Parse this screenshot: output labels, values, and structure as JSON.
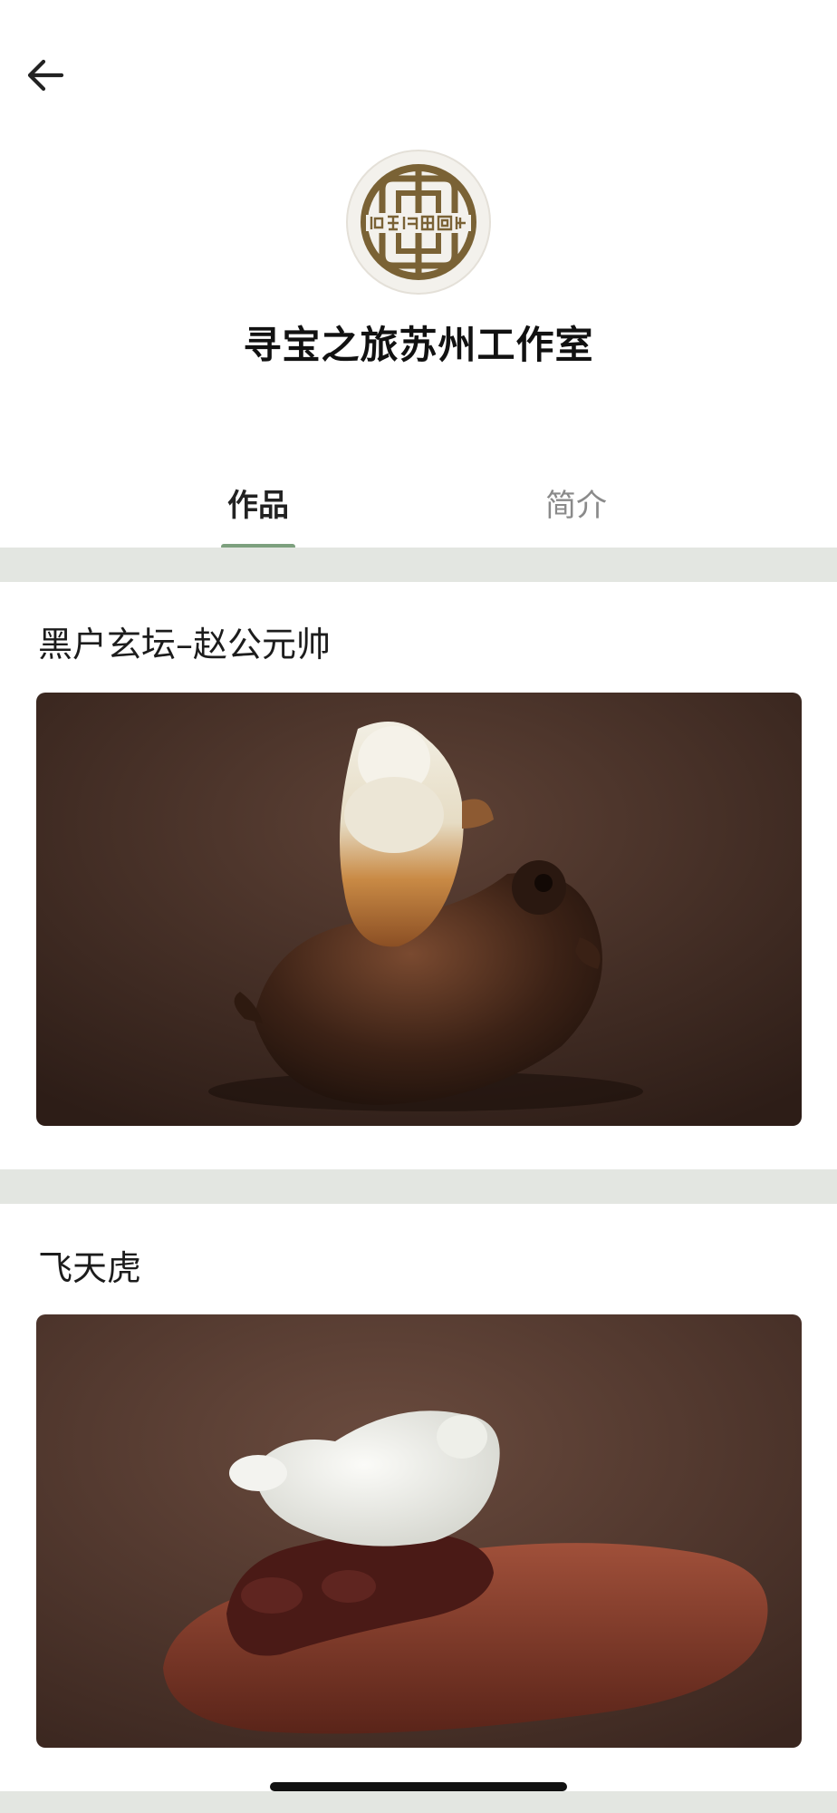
{
  "header": {
    "back_icon": "arrow-left-icon"
  },
  "profile": {
    "name": "寻宝之旅苏州工作室",
    "avatar_icon": "studio-logo-seal"
  },
  "tabs": [
    {
      "label": "作品",
      "active": true
    },
    {
      "label": "简介",
      "active": false
    }
  ],
  "works": [
    {
      "title": "黑户玄坛–赵公元帅"
    },
    {
      "title": "飞天虎"
    }
  ],
  "colors": {
    "accent": "#7da07e",
    "separator": "#e3e6e1",
    "logo_brown": "#7a6235"
  }
}
